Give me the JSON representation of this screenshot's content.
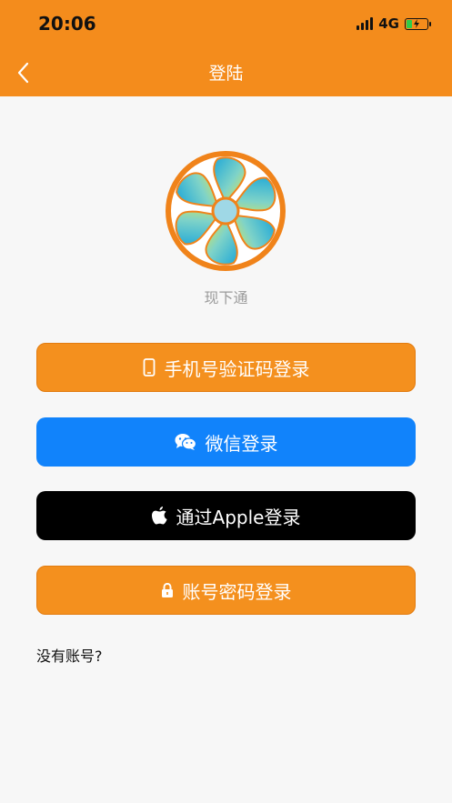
{
  "status_bar": {
    "time": "20:06",
    "network": "4G",
    "battery_level": 0.3
  },
  "nav": {
    "title": "登陆"
  },
  "app": {
    "name": "现下通"
  },
  "buttons": {
    "phone_login": "手机号验证码登录",
    "wechat_login": "微信登录",
    "apple_login": "通过Apple登录",
    "password_login": "账号密码登录"
  },
  "no_account_text": "没有账号?",
  "colors": {
    "primary_orange": "#f48c1c",
    "wechat_blue": "#1183fb",
    "apple_black": "#000000",
    "battery_green": "#2fcc4a"
  },
  "icons": {
    "back": "chevron-left-icon",
    "phone": "mobile-phone-icon",
    "wechat": "wechat-icon",
    "apple": "apple-icon",
    "lock": "lock-icon"
  }
}
